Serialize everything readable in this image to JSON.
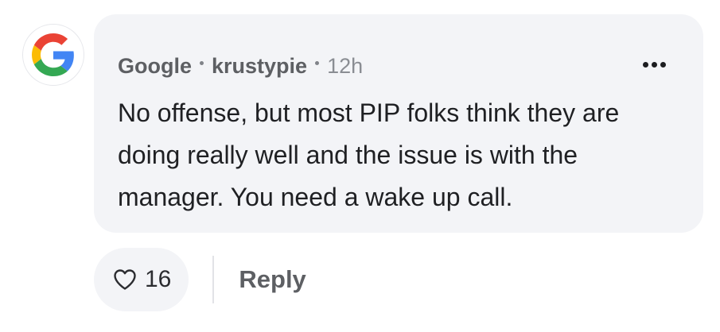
{
  "author": {
    "company": "Google",
    "username": "krustypie",
    "time_ago": "12h",
    "avatar_icon": "google-logo-icon"
  },
  "comment": {
    "text": "No offense, but most PIP folks think they are doing really well and the issue is with the manager. You need a wake up call."
  },
  "actions": {
    "like_icon": "heart-outline-icon",
    "like_count": "16",
    "reply_label": "Reply",
    "more_icon": "ellipsis-icon"
  },
  "colors": {
    "bubble_bg": "#f3f4f7",
    "google_blue": "#4285F4",
    "google_red": "#EA4335",
    "google_yellow": "#FBBC05",
    "google_green": "#34A853"
  }
}
